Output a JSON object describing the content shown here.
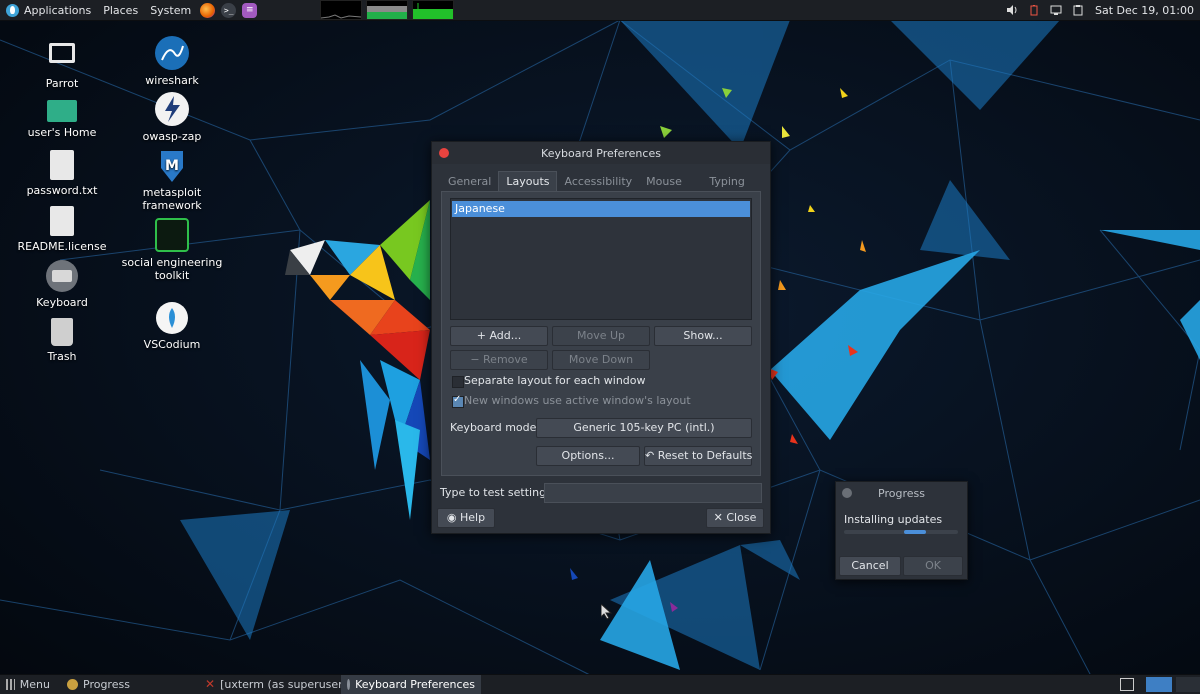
{
  "top_panel": {
    "menus": [
      "Applications",
      "Places",
      "System"
    ],
    "clock": "Sat Dec 19, 01:00",
    "launchers": [
      "firefox-icon",
      "terminal-icon",
      "text-editor-icon"
    ]
  },
  "desktop": {
    "icons": [
      {
        "label": "Parrot",
        "icon": "computer-icon"
      },
      {
        "label": "user's Home",
        "icon": "home-folder-icon"
      },
      {
        "label": "password.txt",
        "icon": "text-file-icon"
      },
      {
        "label": "README.license",
        "icon": "text-file-icon"
      },
      {
        "label": "Keyboard",
        "icon": "keyboard-icon"
      },
      {
        "label": "Trash",
        "icon": "trash-icon"
      },
      {
        "label": "wireshark",
        "icon": "wireshark-icon"
      },
      {
        "label": "owasp-zap",
        "icon": "zap-icon"
      },
      {
        "label": "metasploit framework",
        "icon": "metasploit-icon"
      },
      {
        "label": "social engineering toolkit",
        "icon": "set-icon"
      },
      {
        "label": "VSCodium",
        "icon": "vscodium-icon"
      }
    ]
  },
  "keyboard_prefs": {
    "title": "Keyboard Preferences",
    "tabs": [
      "General",
      "Layouts",
      "Accessibility",
      "Mouse Keys",
      "Typing Break"
    ],
    "active_tab": "Layouts",
    "layouts": [
      "Japanese"
    ],
    "buttons": {
      "add": "+ Add...",
      "move_up": "Move Up",
      "show": "Show...",
      "remove": "− Remove",
      "move_down": "Move Down",
      "options": "Options...",
      "reset": "↶ Reset to Defaults",
      "help": "Help",
      "close": "✕ Close"
    },
    "separate_layout_label": "Separate layout for each window",
    "separate_layout_checked": false,
    "new_windows_label": "New windows use active window's layout",
    "new_windows_checked": true,
    "keyboard_model_label": "Keyboard model:",
    "keyboard_model_value": "Generic 105-key PC (intl.)",
    "test_label": "Type to test settings:",
    "test_value": ""
  },
  "progress_dialog": {
    "title": "Progress",
    "message": "Installing updates",
    "cancel": "Cancel",
    "ok": "OK"
  },
  "taskbar": {
    "menu": "Menu",
    "tasks": [
      {
        "label": "Progress",
        "active": false
      },
      {
        "label": "[uxterm (as superuser)]",
        "active": false
      },
      {
        "label": "Keyboard Preferences",
        "active": true
      }
    ]
  },
  "colors": {
    "accent": "#4b8fd9",
    "close_red": "#e8433f",
    "panel": "#1c1f24"
  }
}
